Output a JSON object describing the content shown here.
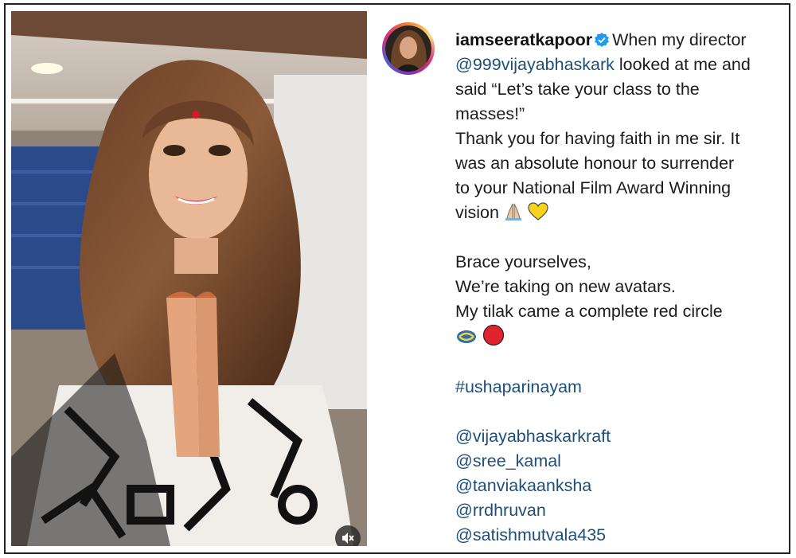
{
  "post": {
    "username": "iamseeratkapoor",
    "mention_director": "@999vijayabhaskark",
    "caption_lines": {
      "l1_suffix": "When my director",
      "l2_suffix": " looked at me and",
      "l3": "said “Let’s take your class to the",
      "l4": "masses!”",
      "l5": "Thank you for having faith in me sir. It",
      "l6": "was an absolute honour to surrender",
      "l7": "to your National Film Award Winning",
      "l8": "vision",
      "l10": "Brace yourselves,",
      "l11": "We’re taking on new avatars.",
      "l12": "My tilak came a complete red circle"
    },
    "hashtag": "#ushaparinayam",
    "mentions": [
      "@vijayabhaskarkraft",
      "@sree_kamal",
      "@tanviakaanksha",
      "@rrdhruvan",
      "@satishmutvala435"
    ]
  },
  "icons": {
    "avatar": "profile-avatar",
    "verified": "verified-badge-icon",
    "mute": "muted-speaker-icon",
    "emojis": [
      "folded-hands-emoji",
      "yellow-heart-emoji",
      "arrows-cycle-emoji",
      "red-circle-emoji"
    ]
  },
  "colors": {
    "link": "#1f4e79",
    "verified": "#1d9bf0",
    "red_circle": "#e0242d",
    "yellow_heart": "#f8d21c"
  }
}
